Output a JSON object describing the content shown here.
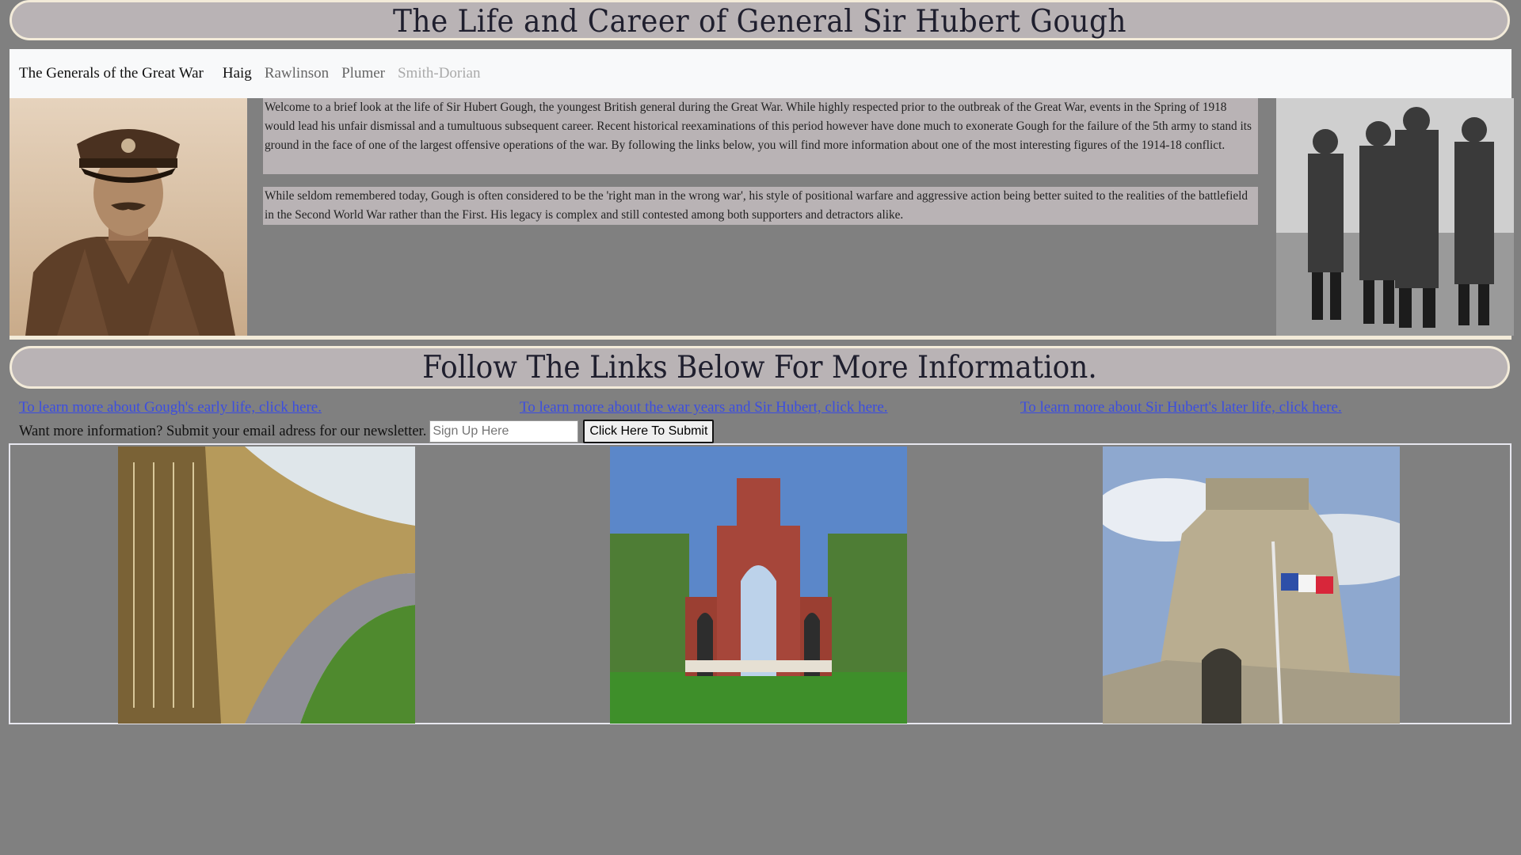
{
  "header": {
    "title": "The Life and Career of General Sir Hubert Gough"
  },
  "nav": {
    "brand": "The Generals of the Great War",
    "items": [
      {
        "label": "Haig",
        "state": "active"
      },
      {
        "label": "Rawlinson",
        "state": "normal"
      },
      {
        "label": "Plumer",
        "state": "normal"
      },
      {
        "label": "Smith-Dorian",
        "state": "disabled"
      }
    ]
  },
  "intro": {
    "paragraph1": "Welcome to a brief look at the life of Sir Hubert Gough, the youngest British general during the Great War. While highly respected prior to the outbreak of the Great War, events in the Spring of 1918 would lead his unfair dismissal and a tumultuous subsequent career. Recent historical reexaminations of this period however have done much to exonerate Gough for the failure of the 5th army to stand its ground in the face of one of the largest offensive operations of the war. By following the links below, you will find more information about one of the most interesting figures of the 1914-18 conflict.",
    "paragraph2": "While seldom remembered today, Gough is often considered to be the 'right man in the wrong war', his style of positional warfare and aggressive action being better suited to the realities of the battlefield in the Second World War rather than the First. His legacy is complex and still contested among both supporters and detractors alike."
  },
  "links_section": {
    "heading": "Follow The Links Below For More Information.",
    "links": [
      "To learn more about Gough's early life, click here.",
      "To learn more about the war years and Sir Hubert, click here.",
      "To learn more about Sir Hubert's later life, click here."
    ]
  },
  "newsletter": {
    "prompt": "Want more information? Submit your email adress for our newsletter.",
    "placeholder": "Sign Up Here",
    "button_label": "Click Here To Submit"
  },
  "colors": {
    "page_bg": "#808080",
    "panel_bg": "#b9b3b5",
    "panel_border": "#f3ebd9",
    "link": "#3b4de0"
  }
}
